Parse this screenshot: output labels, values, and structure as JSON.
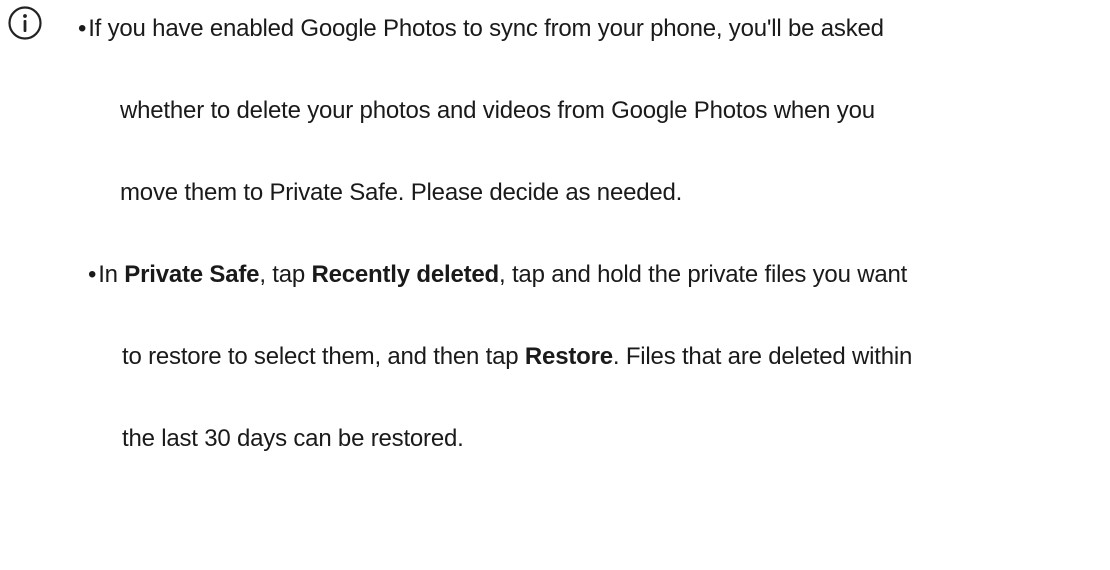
{
  "icon": "info-circle-icon",
  "notes": [
    {
      "bullet": "•",
      "lines": [
        "If you have enabled Google Photos to sync from your phone, you'll be asked",
        "whether to delete your photos and videos from Google Photos when you",
        "move them to Private Safe. Please decide as needed."
      ]
    },
    {
      "bullet": "•",
      "line1": {
        "t1": "In ",
        "b1": "Private Safe",
        "t2": ", tap ",
        "b2": "Recently deleted",
        "t3": ", tap and hold the private files you want"
      },
      "line2": {
        "t1": "to restore to select them, and then tap ",
        "b1": "Restore",
        "t2": ". Files that are deleted within"
      },
      "line3": "the last 30 days can be restored."
    }
  ]
}
